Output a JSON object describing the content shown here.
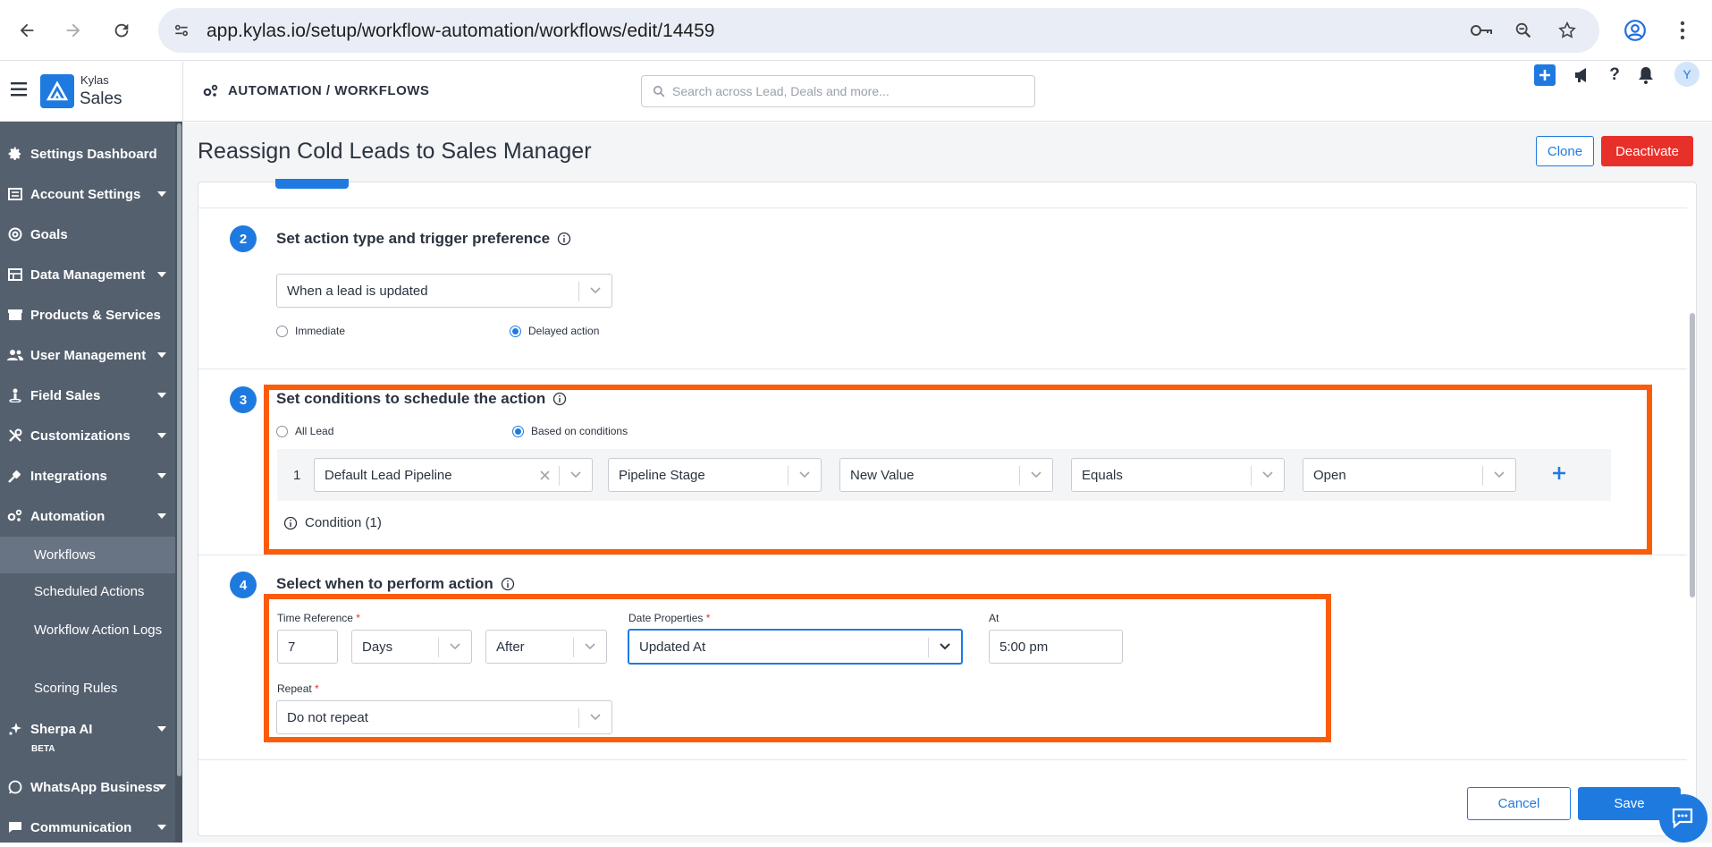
{
  "browser": {
    "url": "app.kylas.io/setup/workflow-automation/workflows/edit/14459"
  },
  "header": {
    "brand_top": "Kylas",
    "brand_main": "Sales",
    "breadcrumb": "AUTOMATION / WORKFLOWS",
    "search_placeholder": "Search across Lead, Deals and more...",
    "avatar_initial": "Y"
  },
  "sidebar": {
    "items": [
      {
        "label": "Settings Dashboard",
        "icon": "gear-icon",
        "caret": false
      },
      {
        "label": "Account Settings",
        "icon": "account-icon",
        "caret": true
      },
      {
        "label": "Goals",
        "icon": "target-icon",
        "caret": false
      },
      {
        "label": "Data Management",
        "icon": "table-icon",
        "caret": true
      },
      {
        "label": "Products & Services",
        "icon": "box-icon",
        "caret": false
      },
      {
        "label": "User Management",
        "icon": "users-icon",
        "caret": true
      },
      {
        "label": "Field Sales",
        "icon": "person-pin-icon",
        "caret": true
      },
      {
        "label": "Customizations",
        "icon": "tools-icon",
        "caret": true
      },
      {
        "label": "Integrations",
        "icon": "plug-icon",
        "caret": true
      },
      {
        "label": "Automation",
        "icon": "automation-icon",
        "caret": true
      }
    ],
    "sub_items": [
      "Workflows",
      "Scheduled Actions",
      "Workflow Action Logs",
      "Scoring Rules"
    ],
    "bottom_items": [
      {
        "label": "Sherpa AI",
        "icon": "sparkle-icon",
        "caret": true
      },
      {
        "label": "WhatsApp Business",
        "icon": "whatsapp-icon",
        "caret": true
      },
      {
        "label": "Communication",
        "icon": "chat-icon",
        "caret": true
      }
    ],
    "beta": "BETA"
  },
  "page": {
    "title": "Reassign Cold Leads to Sales Manager",
    "clone_label": "Clone",
    "deactivate_label": "Deactivate",
    "cancel_label": "Cancel",
    "save_label": "Save"
  },
  "step2": {
    "number": "2",
    "title": "Set action type and trigger preference",
    "trigger": "When a lead is updated",
    "radio_immediate": "Immediate",
    "radio_delayed": "Delayed action",
    "selected": "Delayed action"
  },
  "step3": {
    "number": "3",
    "title": "Set conditions to schedule the action",
    "radio_all": "All Lead",
    "radio_based": "Based on conditions",
    "selected": "Based on conditions",
    "row_number": "1",
    "pipeline": "Default Lead Pipeline",
    "field": "Pipeline Stage",
    "value_type": "New Value",
    "operator": "Equals",
    "value": "Open",
    "condition_count": "Condition (1)"
  },
  "step4": {
    "number": "4",
    "title": "Select when to perform action",
    "time_reference_label": "Time Reference",
    "time_value": "7",
    "time_unit": "Days",
    "time_direction": "After",
    "date_properties_label": "Date Properties",
    "date_property": "Updated At",
    "at_label": "At",
    "at_value": "5:00 pm",
    "repeat_label": "Repeat",
    "repeat_value": "Do not repeat",
    "required_mark": "*"
  },
  "colors": {
    "accent": "#1f7ae0",
    "danger": "#e8302a",
    "highlight": "#fb5c08",
    "sidebar": "#55606f"
  }
}
